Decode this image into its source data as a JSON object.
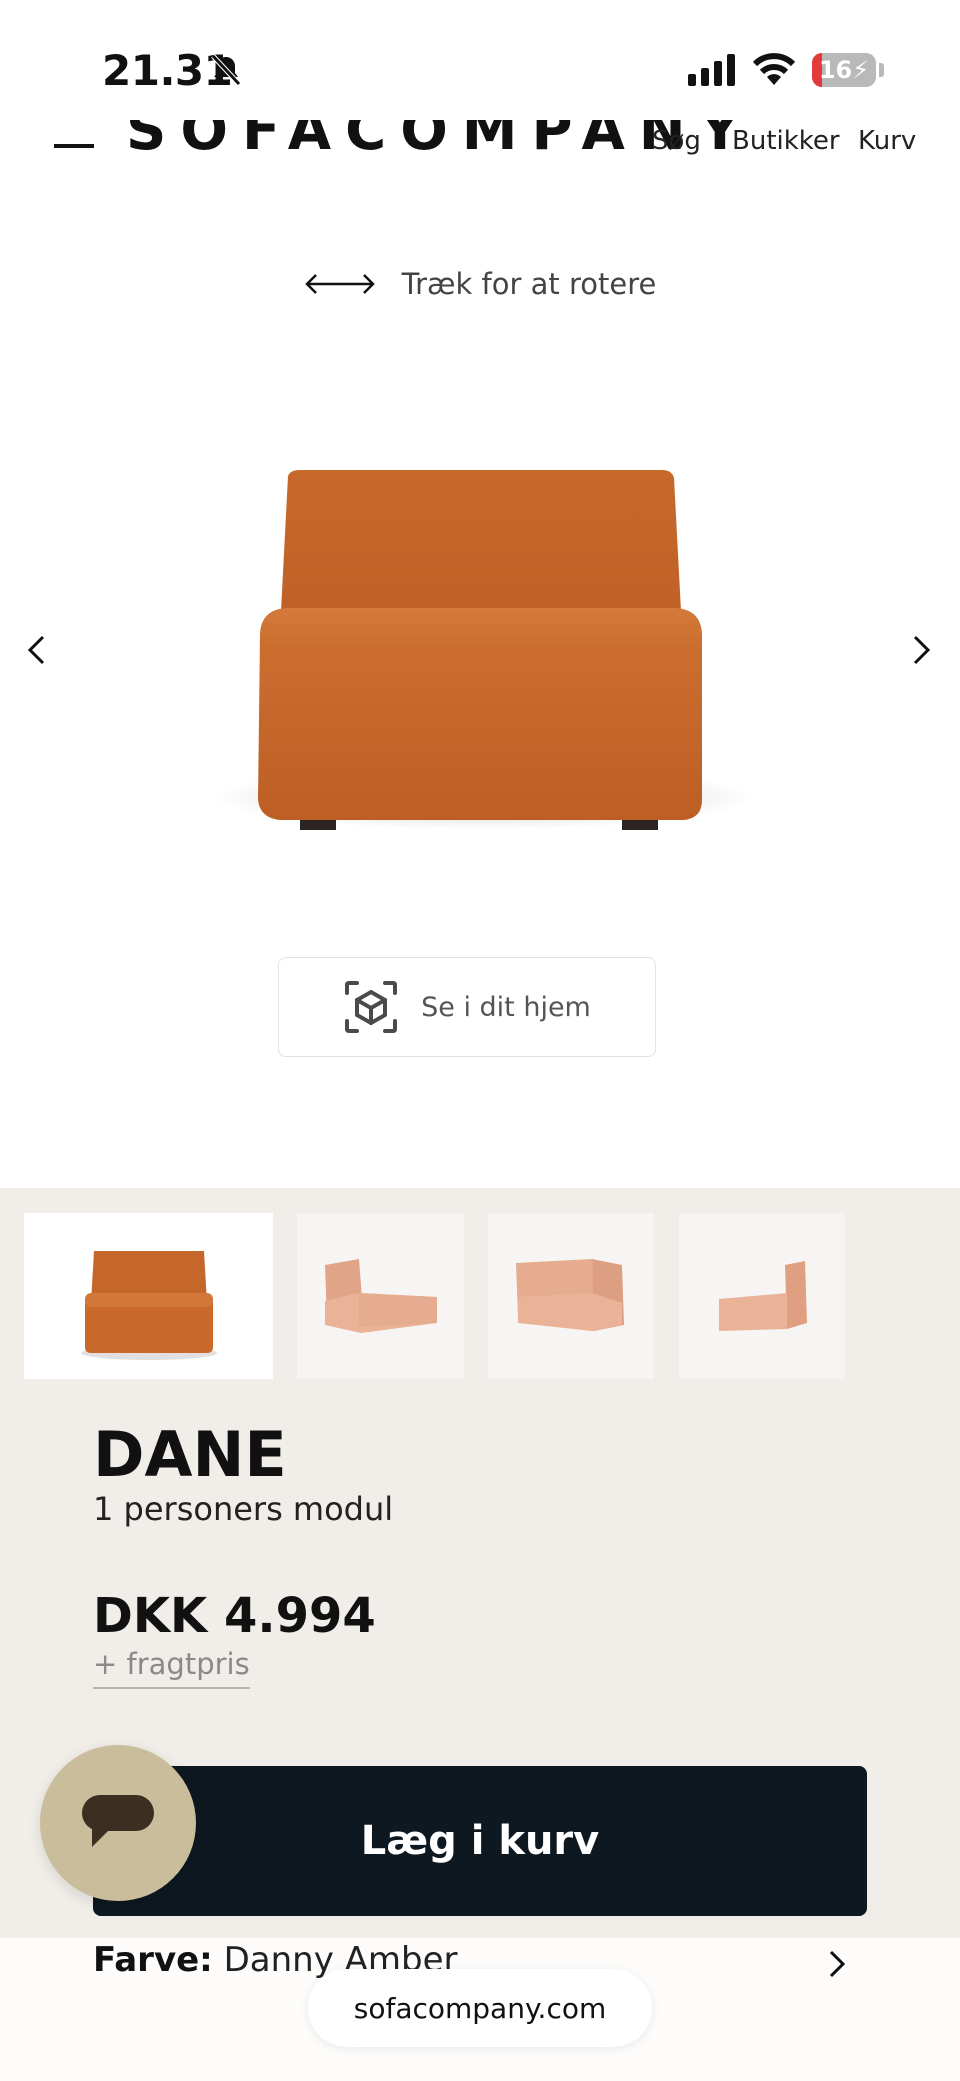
{
  "status_bar": {
    "time": "21.31",
    "battery": "16",
    "battery_level": 0.16,
    "icons": [
      "bell-slash-icon",
      "signal-icon",
      "wifi-icon",
      "battery-icon"
    ]
  },
  "header": {
    "logo": "SOFACOMPANY",
    "nav": {
      "search": "Søg",
      "stores": "Butikker",
      "cart": "Kurv"
    }
  },
  "viewer": {
    "rotate_hint": "Træk for at rotere",
    "ar_button": "Se i dit hjem",
    "thumbnail_count": 4,
    "selected_thumbnail": 0
  },
  "product": {
    "name": "DANE",
    "subtitle": "1 personers modul",
    "price": "DKK 4.994",
    "freight": "+ fragtpris",
    "add_to_cart": "Læg i kurv",
    "color_label": "Farve:",
    "color_value": "Danny Amber"
  },
  "browser": {
    "url": "sofacompany.com"
  },
  "colors": {
    "sofa": "#c86a2c",
    "thumb_sofa": "#e8b196",
    "button": "#0d1821",
    "info_background": "#f1eee9",
    "chat_bubble": "#c9bd9c"
  }
}
